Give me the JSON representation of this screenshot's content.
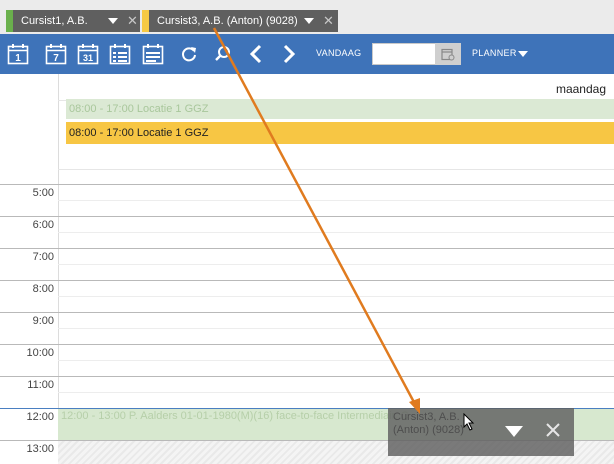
{
  "tabs": [
    {
      "label": "Cursist1, A.B.",
      "color": "#6ab04c"
    },
    {
      "label": "Cursist3, A.B. (Anton) (9028)",
      "color": "#f6c944"
    }
  ],
  "toolbar": {
    "calendar_day_num": "1",
    "calendar_week_num": "7",
    "calendar_month_num": "31",
    "today_label": "VANDAAG",
    "date_value": "",
    "planner_label": "PLANNER"
  },
  "calendar": {
    "day_label": "maandag",
    "allday_events": [
      {
        "text": "08:00 - 17:00 Locatie 1 GGZ",
        "color": "#dbe9d4"
      },
      {
        "text": "08:00 - 17:00 Locatie 1 GGZ",
        "color": "#f7c644"
      }
    ],
    "hours": [
      "5:00",
      "6:00",
      "7:00",
      "8:00",
      "9:00",
      "10:00",
      "11:00",
      "12:00",
      "13:00"
    ],
    "timed_events": [
      {
        "text": "12:00 - 13:00 P. Aalders 01-01-1980(M)(16) face-to-face Intermediair, C."
      }
    ]
  },
  "drag_preview": {
    "text": "Cursist3, A.B. (Anton) (9028)"
  },
  "colors": {
    "toolbar": "#3e73b9",
    "tab_bg": "#5f5f5f",
    "arrow": "#e07b1f"
  }
}
